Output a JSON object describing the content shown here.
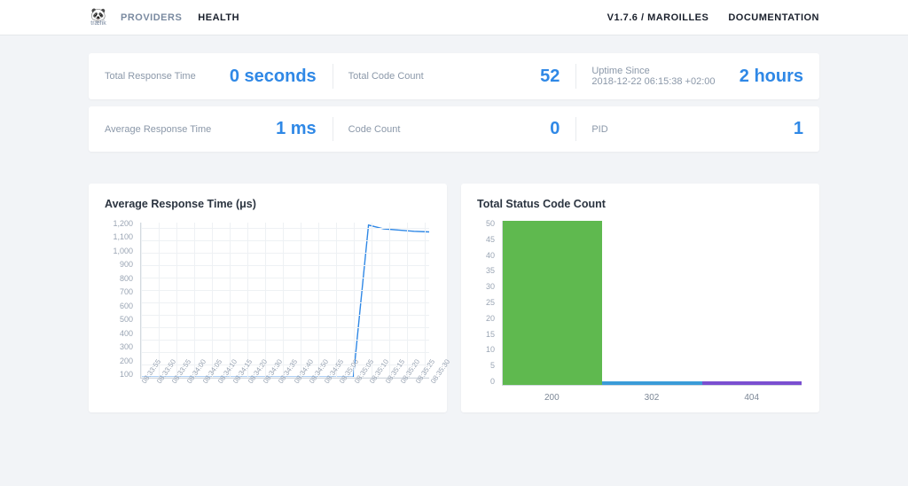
{
  "nav": {
    "providers": "PROVIDERS",
    "health": "HEALTH",
    "version": "V1.7.6 / MAROILLES",
    "documentation": "DOCUMENTATION",
    "logo_text": "træfik"
  },
  "stats_row1": {
    "total_response_time_label": "Total Response Time",
    "total_response_time_value": "0 seconds",
    "total_code_count_label": "Total Code Count",
    "total_code_count_value": "52",
    "uptime_since_label": "Uptime Since",
    "uptime_since_detail": "2018-12-22 06:15:38 +02:00",
    "uptime_since_value": "2 hours"
  },
  "stats_row2": {
    "avg_response_time_label": "Average Response Time",
    "avg_response_time_value": "1 ms",
    "code_count_label": "Code Count",
    "code_count_value": "0",
    "pid_label": "PID",
    "pid_value": "1"
  },
  "chart1": {
    "title": "Average Response Time (μs)"
  },
  "chart2": {
    "title": "Total Status Code Count"
  },
  "chart_data": [
    {
      "type": "line",
      "title": "Average Response Time (μs)",
      "xlabel": "",
      "ylabel": "",
      "ylim": [
        0,
        1250
      ],
      "x": [
        "08:33:55",
        "08:33:50",
        "08:33:55",
        "08:34:00",
        "08:34:05",
        "08:34:10",
        "08:34:15",
        "08:34:20",
        "08:34:30",
        "08:34:35",
        "08:34:40",
        "08:34:50",
        "08:34:55",
        "08:35:00",
        "08:35:05",
        "08:35:10",
        "08:35:15",
        "08:35:20",
        "08:35:25",
        "08:35:30"
      ],
      "y": [
        5,
        5,
        5,
        5,
        5,
        5,
        5,
        5,
        5,
        5,
        5,
        5,
        5,
        5,
        5,
        1230,
        1200,
        1190,
        1180,
        1175
      ],
      "yticks": [
        1200,
        1100,
        1000,
        900,
        800,
        700,
        600,
        500,
        400,
        300,
        200,
        100
      ]
    },
    {
      "type": "bar",
      "title": "Total Status Code Count",
      "ylim": [
        0,
        50
      ],
      "yticks": [
        50,
        45,
        40,
        35,
        30,
        25,
        20,
        15,
        10,
        5,
        0
      ],
      "categories": [
        "200",
        "302",
        "404"
      ],
      "values": [
        50,
        1,
        1
      ],
      "colors": [
        "#5fb94f",
        "#3a9bd8",
        "#7a4fd0"
      ]
    }
  ]
}
